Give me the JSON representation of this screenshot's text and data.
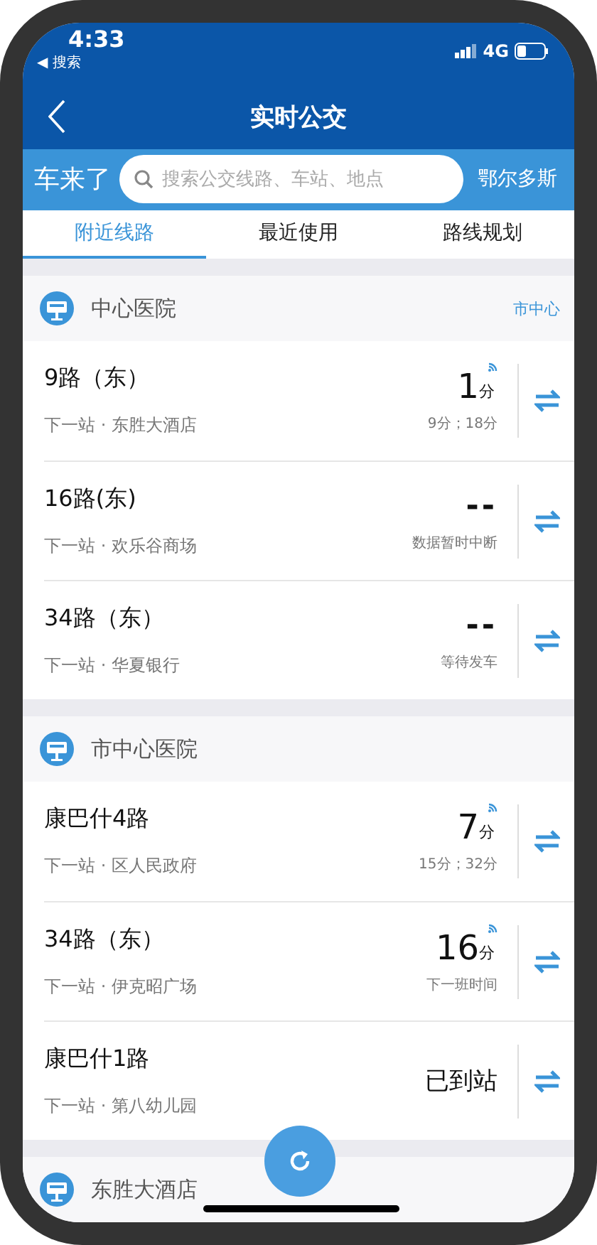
{
  "status_bar": {
    "time": "4:33",
    "back_app": "◀ 搜索",
    "network": "4G"
  },
  "nav": {
    "title": "实时公交"
  },
  "search": {
    "brand": "车来了",
    "placeholder": "搜索公交线路、车站、地点",
    "city": "鄂尔多斯"
  },
  "tabs": [
    {
      "label": "附近线路",
      "selected": true
    },
    {
      "label": "最近使用",
      "selected": false
    },
    {
      "label": "路线规划",
      "selected": false
    }
  ],
  "stations": [
    {
      "name": "中心医院",
      "area": "市中心",
      "routes": [
        {
          "name": "9路（东）",
          "next_stop": "下一站 · 东胜大酒店",
          "kind": "eta",
          "time": "1",
          "unit": "分",
          "note": "9分；18分"
        },
        {
          "name": "16路(东)",
          "next_stop": "下一站 · 欢乐谷商场",
          "kind": "none",
          "time": "--",
          "note": "数据暂时中断"
        },
        {
          "name": "34路（东）",
          "next_stop": "下一站 · 华夏银行",
          "kind": "none",
          "time": "--",
          "note": "等待发车"
        }
      ]
    },
    {
      "name": "市中心医院",
      "routes": [
        {
          "name": "康巴什4路",
          "next_stop": "下一站 · 区人民政府",
          "kind": "eta",
          "time": "7",
          "unit": "分",
          "note": "15分；32分"
        },
        {
          "name": "34路（东）",
          "next_stop": "下一站 · 伊克昭广场",
          "kind": "eta",
          "time": "16",
          "unit": "分",
          "note": "下一班时间"
        },
        {
          "name": "康巴什1路",
          "next_stop": "下一站 · 第八幼儿园",
          "kind": "arrived",
          "time": "已到站"
        }
      ]
    },
    {
      "name": "东胜大酒店"
    }
  ]
}
